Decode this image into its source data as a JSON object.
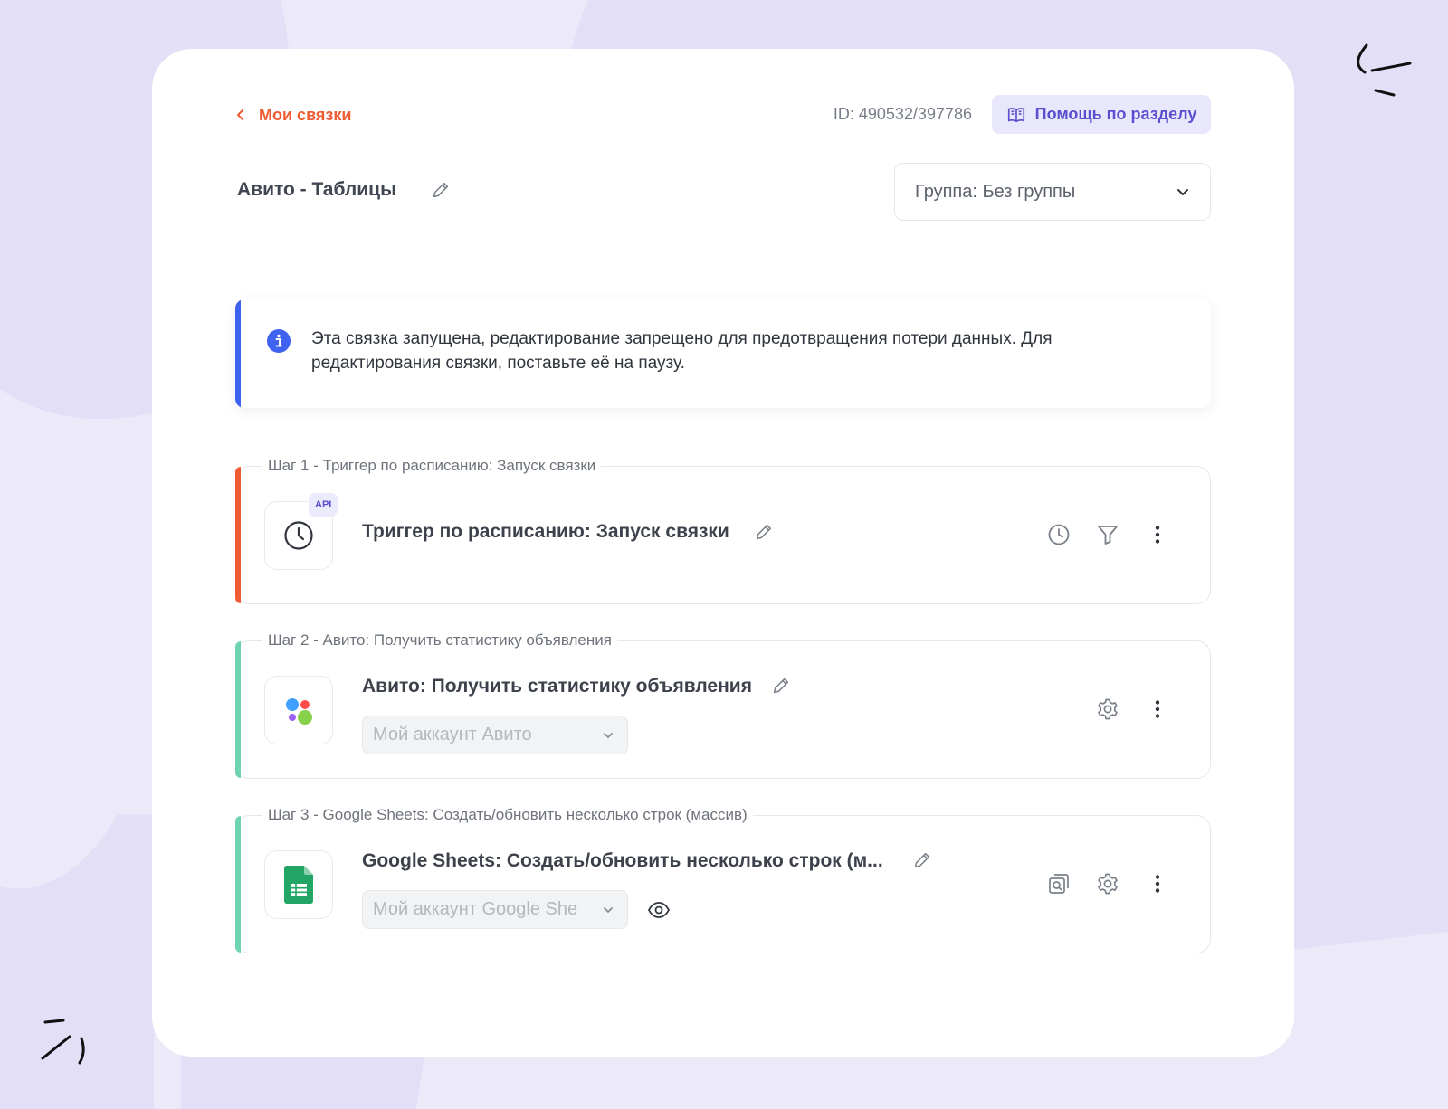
{
  "header": {
    "back_label": "Мои связки",
    "id_text": "ID: 490532/397786",
    "help_label": "Помощь по разделу"
  },
  "title": {
    "text": "Авито - Таблицы"
  },
  "group_select": {
    "value": "Группа: Без группы"
  },
  "info_banner": {
    "text": "Эта связка запущена, редактирование запрещено для предотвращения потери данных. Для редактирования связки, поставьте её на паузу."
  },
  "steps": [
    {
      "legend": "Шаг 1 - Триггер по расписанию: Запуск связки",
      "title": "Триггер по расписанию: Запуск связки",
      "badge": "API",
      "icon": "clock-icon",
      "accent": "#ef5b33",
      "actions": [
        "clock-icon",
        "filter-icon",
        "more-vertical-icon"
      ]
    },
    {
      "legend": "Шаг 2 - Авито: Получить статистику объявления",
      "title": "Авито: Получить статистику объявления",
      "account": "Мой аккаунт Авито",
      "icon": "avito-logo-icon",
      "accent": "#6fd3b1",
      "actions": [
        "gear-icon",
        "more-vertical-icon"
      ]
    },
    {
      "legend": "Шаг 3 - Google Sheets: Создать/обновить несколько строк (массив)",
      "title": "Google Sheets: Создать/обновить несколько строк (м...",
      "account": "Мой аккаунт Google She",
      "icon": "google-sheets-icon",
      "accent": "#6fd3b1",
      "actions": [
        "eye-icon",
        "search-copy-icon",
        "gear-icon",
        "more-vertical-icon"
      ]
    }
  ],
  "colors": {
    "accent_orange": "#ef5b33",
    "accent_blue": "#3d63f0",
    "accent_green": "#6fd3b1",
    "help_purple": "#5a4fcf",
    "background": "#e6e3f8"
  }
}
